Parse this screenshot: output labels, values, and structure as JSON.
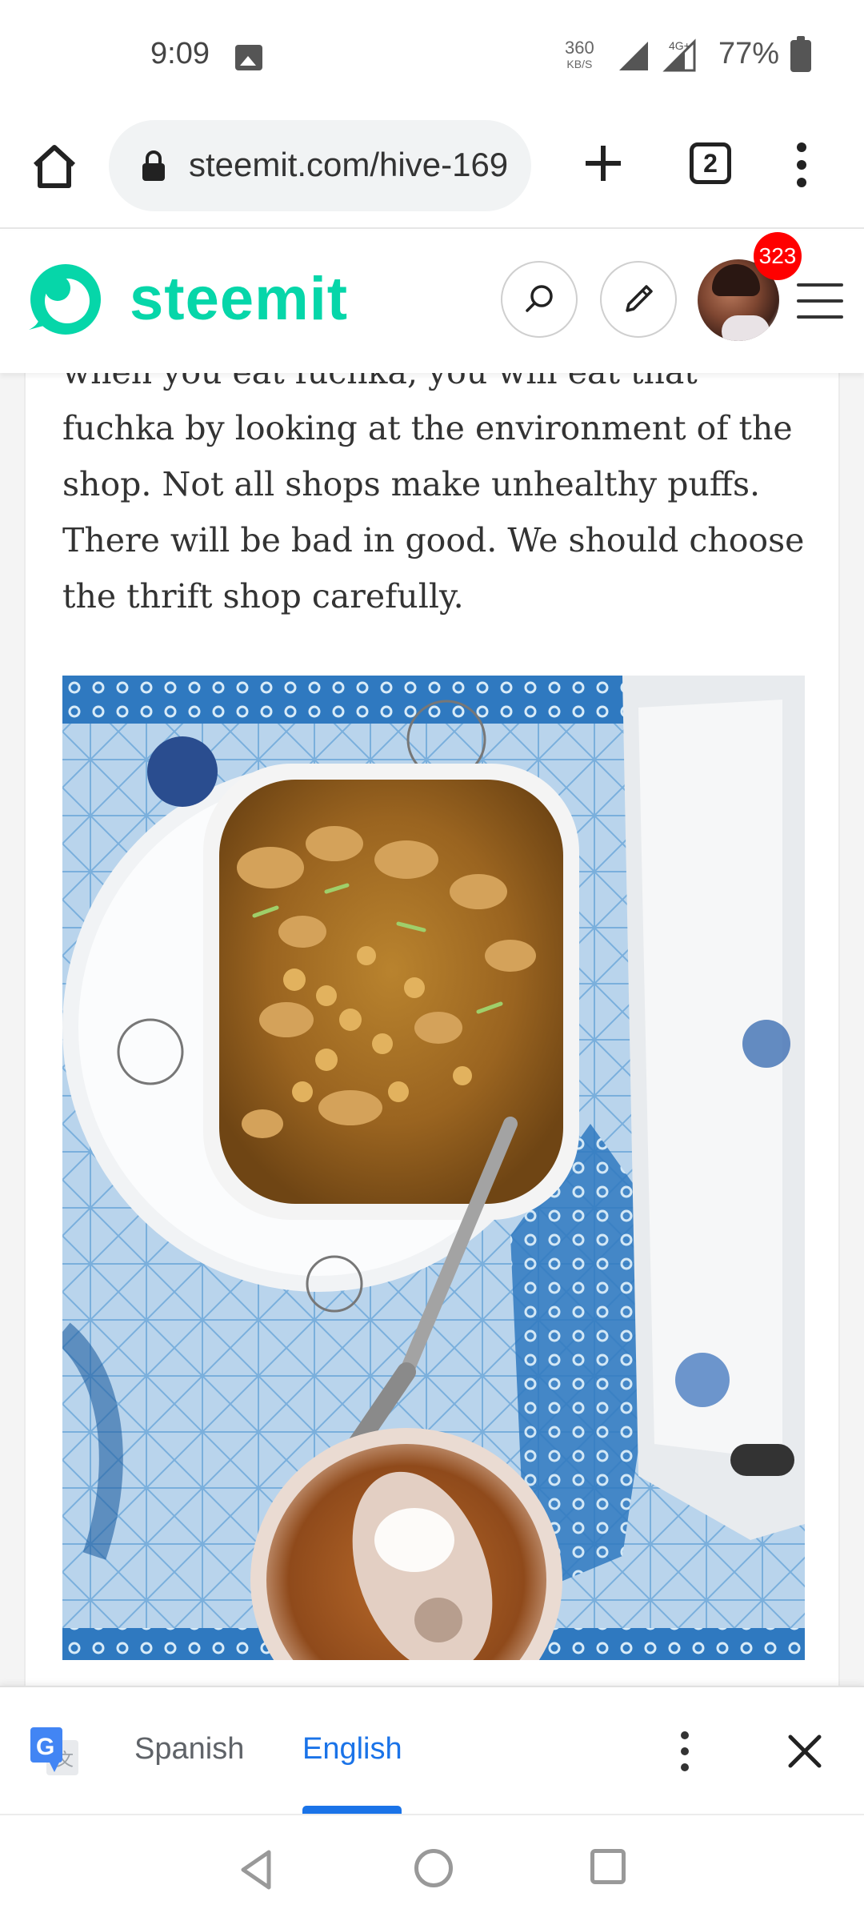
{
  "status_bar": {
    "time": "9:09",
    "net_speed_value": "360",
    "net_speed_unit": "KB/S",
    "network_label": "4G+",
    "battery": "77%"
  },
  "browser": {
    "url": "steemit.com/hive-169",
    "tab_count": "2"
  },
  "steemit_header": {
    "brand": "steemit",
    "notification_count": "323",
    "brand_color": "#06d6a9"
  },
  "article": {
    "paragraph_lines": [
      "when you eat fuchka, you will eat that",
      "fuchka by looking at the environment of the",
      "shop. Not all shops make unhealthy puffs.",
      "There will be bad in good. We should choose",
      "the thrift shop carefully."
    ]
  },
  "translate_bar": {
    "source_language": "Spanish",
    "target_language": "English",
    "accent_color": "#1a73e8"
  }
}
